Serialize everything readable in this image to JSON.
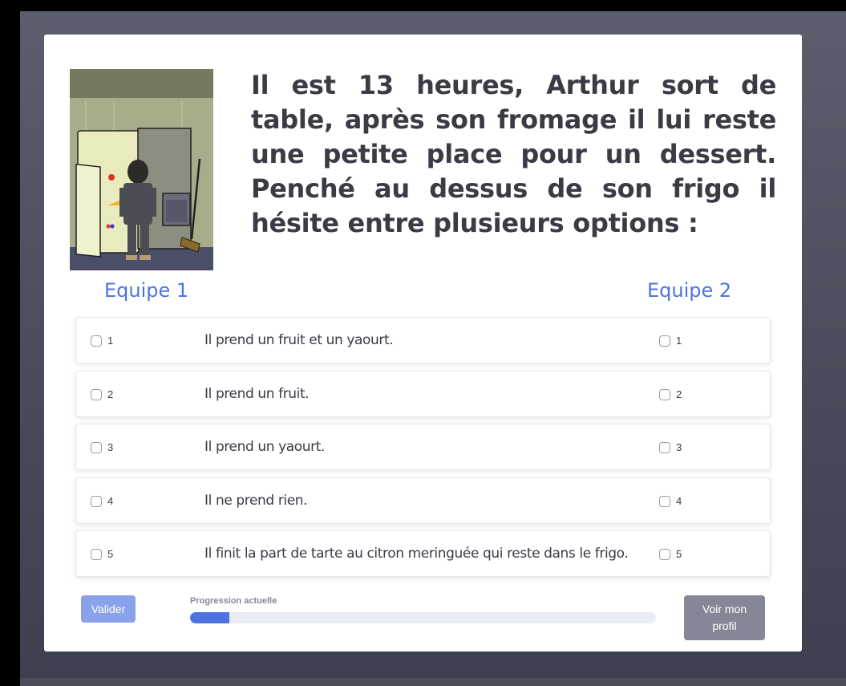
{
  "question": {
    "text": "Il est 13 heures, Arthur sort de table, après son fromage il lui reste une petite place pour un dessert. Penché au dessus de son frigo il hésite entre plusieurs options :"
  },
  "teams": {
    "team1_label": "Equipe 1",
    "team2_label": "Equipe 2"
  },
  "options": [
    {
      "left_num": "1",
      "text": "Il prend un fruit et un yaourt.",
      "right_num": "1"
    },
    {
      "left_num": "2",
      "text": "Il prend un fruit.",
      "right_num": "2"
    },
    {
      "left_num": "3",
      "text": "Il prend un yaourt.",
      "right_num": "3"
    },
    {
      "left_num": "4",
      "text": "Il ne prend rien.",
      "right_num": "4"
    },
    {
      "left_num": "5",
      "text": "Il finit la part de tarte au citron meringuée qui reste dans le frigo.",
      "right_num": "5"
    }
  ],
  "footer": {
    "validate_label": "Valider",
    "progress_label": "Progression actuelle",
    "progress_fraction": 0.085,
    "profile_label": "Voir mon profil"
  },
  "colors": {
    "accent": "#4e73df",
    "validate_bg": "#8aa2ea",
    "profile_bg": "#858796"
  }
}
